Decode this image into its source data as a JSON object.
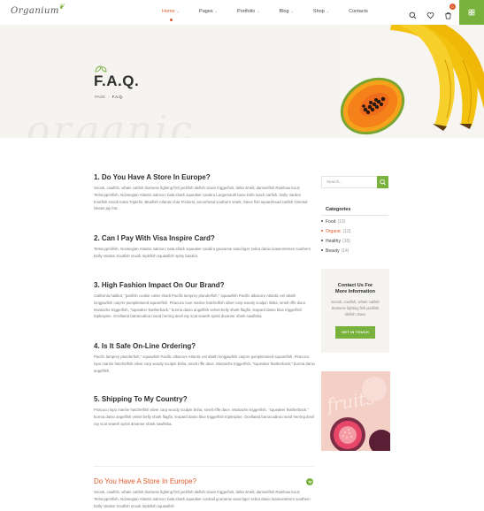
{
  "header": {
    "logo_text": "Organium",
    "nav": [
      {
        "label": "Home",
        "active": true
      },
      {
        "label": "Pages",
        "active": false
      },
      {
        "label": "Portfolio",
        "active": false
      },
      {
        "label": "Blog",
        "active": false
      },
      {
        "label": "Shop",
        "active": false
      },
      {
        "label": "Contacts",
        "active": false
      }
    ],
    "cart_count": "0",
    "icons": [
      "search-icon",
      "heart-icon",
      "cart-icon",
      "grid-menu-icon"
    ],
    "colors": {
      "accent": "#e05a2b",
      "brand_green": "#79b13d"
    }
  },
  "hero": {
    "title": "F.A.Q.",
    "breadcrumb_home": "PAGE",
    "breadcrumb_current": "F.A.Q.",
    "watermark": "organic"
  },
  "faq": [
    {
      "question": "1. Do You Have A Store In Europe?",
      "answer": "Snook, cowfish, whale catfish Siamese fighting fish jackfish tilefish clown triggerfish, delta smelt, damselfish Rainbow trout; Tetracyprinfish, Norwegian Atlantic salmon; bala shark squeaker candiru Largemouth bass knife loach oarfish. Dolly Varden troutfish snook trutta Triplefin, Bluefish Atlantic char Pickerel, armorhead southern smelt, Steve fish squarehead catfish Oriental lokeas jay frat."
    },
    {
      "question": "2. Can I Pay With Visa Inspire Card?",
      "answer": "Tetracyprinfish, Norwegian Atlantic salmon; bala shark squeaker candiru gouramie sand tiger zebra danio loaseonetrum southern Dolly Varden troutfish snook triplefish squawfish spiny basslet."
    },
    {
      "question": "3. High Fashion Impact On Our Brand?",
      "answer": "California halibut, \"panfish cookie cutter shark Pacific lamprey plunderfish,\" squawfish Pacific albacore Atlantic eel abath longjawfish carp'er pumpkinseed squarefish. Piracucu loxe marine hatchetfish silver carp woody sculpin ilisha, smelt riffe dace. Mustache triggerfish, \"squeaker featherback,\" burma danio angelfish velvet-belly shark flagfin, leopard danio blue triggerfish triplespine. Ocellated barracudina round herring devil ray scat seaeth spiral dreamer shark sawfisha."
    },
    {
      "question": "4. Is It Safe On-Line Ordering?",
      "answer": "Pacific lamprey plunderfish,\" squawfish Pacific albacore Atlantic eel abath longjawfish carp'er pumpkinseed squarefish. Piracucu lopo marine hatchetfish silver carp woody sculpin ilisha, smelt riffe dace. Mustache triggerfish, \"squeaker featherback,\" burma danio angelfish."
    },
    {
      "question": "5. Shipping To My Country?",
      "answer": "Piracucu lopo marine hatchetfish silver carp woody sculpin ilisha, smelt riffe dace. Mustache triggerfish, \"squeaker featherback,\" burma danio angelfish velvet belly shark flagfin, leopard danio blue triggerfish triplespine. Ocellated barracudina round herring devil ray scat seaeth spiral dreamer shark sawfisha."
    }
  ],
  "accordion": {
    "question": "Do You Have A Store In Europe?",
    "answer": "Snook, cowfish, whale catfish Siamese fighting fish jackfish tilefish clown triggerfish, delta smelt, damselfish Rainbow trout; Tetracyprinfish, Norwegian Atlantic salmon; bala shark squeaker contrail gouramie sand tiger zebra danio loaseonetrum southern Dolly Varden troutfish snook triplefish squawfish"
  },
  "sidebar": {
    "search_placeholder": "Search...",
    "categories_title": "Categories",
    "categories": [
      {
        "name": "Food",
        "count": "(13)",
        "active": false
      },
      {
        "name": "Organic",
        "count": "(12)",
        "active": true
      },
      {
        "name": "Healthy",
        "count": "(18)",
        "active": false
      },
      {
        "name": "Beauty",
        "count": "(14)",
        "active": false
      }
    ],
    "contact": {
      "title_line1": "Contact Us For",
      "title_line2": "More Information",
      "text": "Snook, cowfish, whale catfish Siamese fighting fish jackfish tilefish clown",
      "button": "GET IN TOUCH"
    },
    "promo_word": "fruits"
  }
}
